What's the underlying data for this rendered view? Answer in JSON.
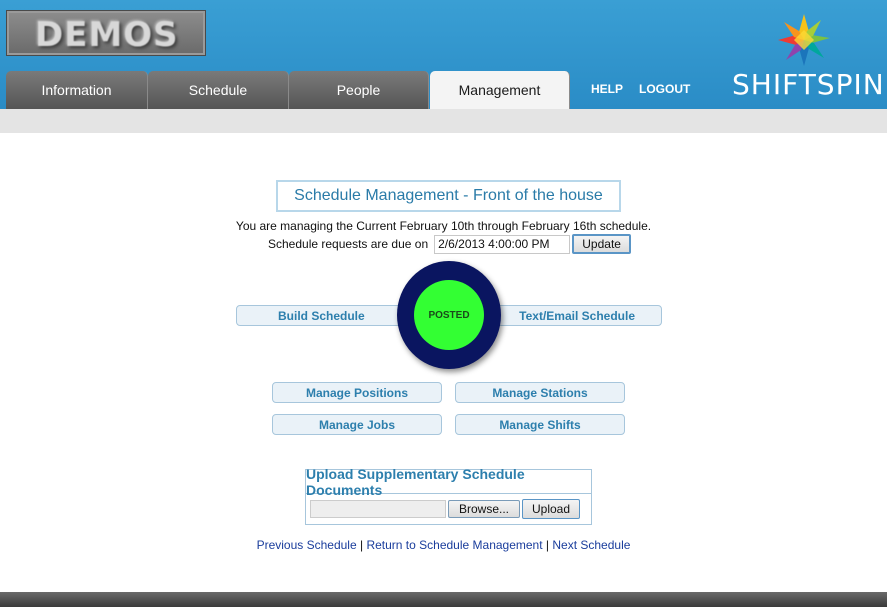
{
  "header": {
    "logo_text": "DEMOS",
    "brand_name": "SHIFTSPIN",
    "tabs": [
      {
        "label": "Information"
      },
      {
        "label": "Schedule"
      },
      {
        "label": "People"
      },
      {
        "label": "Management"
      }
    ],
    "active_tab": "Management",
    "links": {
      "help": "HELP",
      "logout": "LOGOUT"
    }
  },
  "main": {
    "title": "Schedule Management - Front of the house",
    "managing_text": "You are managing the Current February 10th through February 16th schedule.",
    "due_label": "Schedule requests are due on",
    "due_value": "2/6/2013 4:00:00 PM",
    "update_label": "Update",
    "build_schedule": "Build Schedule",
    "text_email_schedule": "Text/Email Schedule",
    "status": "POSTED",
    "manage_positions": "Manage Positions",
    "manage_stations": "Manage Stations",
    "manage_jobs": "Manage Jobs",
    "manage_shifts": "Manage Shifts"
  },
  "upload": {
    "title": "Upload Supplementary Schedule Documents",
    "browse_label": "Browse...",
    "upload_label": "Upload"
  },
  "nav": {
    "previous": "Previous Schedule",
    "return": "Return to Schedule Management",
    "next": "Next Schedule",
    "separator": "|"
  },
  "colors": {
    "header_blue": "#2a8cc6",
    "status_ring": "#0a1560",
    "status_fill": "#33ff33",
    "link_blue": "#2d7fad"
  }
}
